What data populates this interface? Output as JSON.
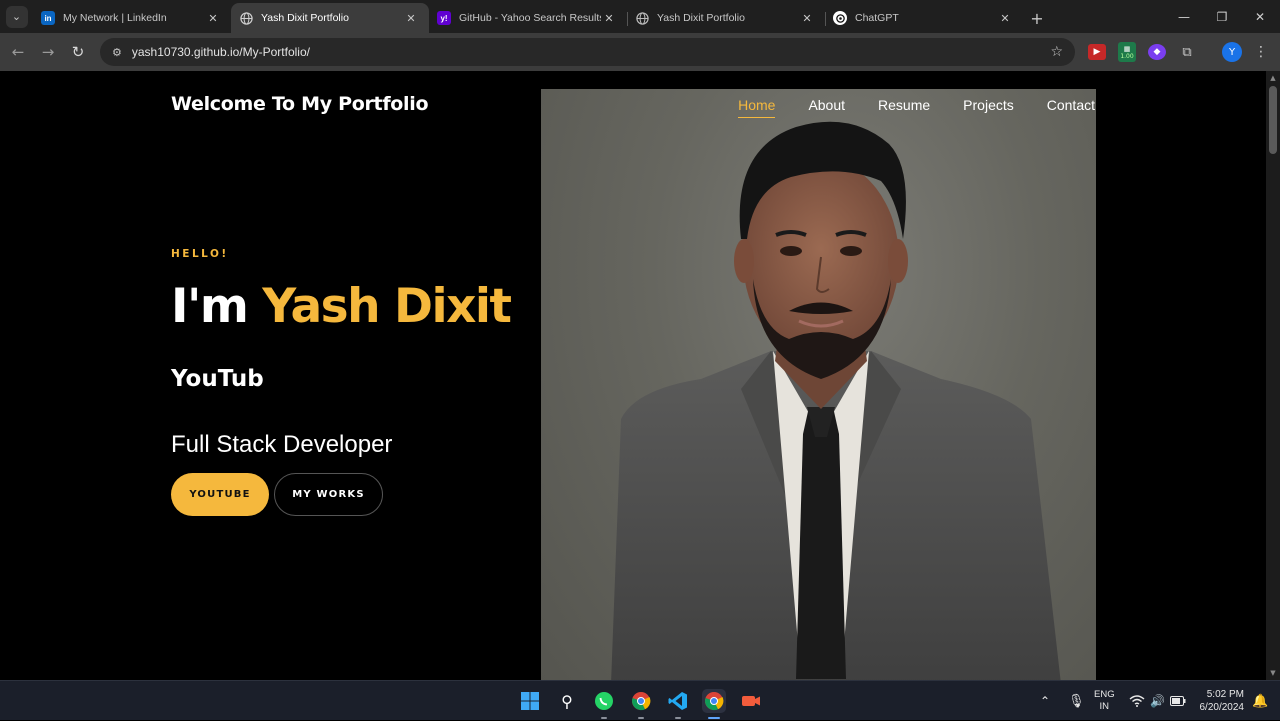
{
  "browser": {
    "tabs": [
      {
        "title": "My Network | LinkedIn",
        "favicon": "linkedin-icon",
        "favicon_text": "in",
        "color": "#0a66c2",
        "active": false
      },
      {
        "title": "Yash Dixit Portfolio",
        "favicon": "globe-icon",
        "favicon_text": "",
        "color": "#555555",
        "active": true
      },
      {
        "title": "GitHub - Yahoo Search Results",
        "favicon": "yahoo-icon",
        "favicon_text": "y!",
        "color": "#6001d2",
        "active": false
      },
      {
        "title": "Yash Dixit Portfolio",
        "favicon": "globe-icon",
        "favicon_text": "",
        "color": "#555555",
        "active": false
      },
      {
        "title": "ChatGPT",
        "favicon": "chatgpt-icon",
        "favicon_text": "",
        "color": "#ffffff",
        "active": false
      }
    ],
    "url": "yash10730.github.io/My-Portfolio/",
    "profile_initial": "Y",
    "extension_badge": "1.00"
  },
  "page": {
    "brand": "Welcome To My Portfolio",
    "nav": [
      {
        "label": "Home",
        "active": true
      },
      {
        "label": "About",
        "active": false
      },
      {
        "label": "Resume",
        "active": false
      },
      {
        "label": "Projects",
        "active": false
      },
      {
        "label": "Contact",
        "active": false
      }
    ],
    "hello": "HELLO!",
    "intro_prefix": "I'm",
    "intro_name": "Yash Dixit",
    "typing_text": "YouTub",
    "role": "Full Stack Developer",
    "buttons": {
      "youtube": "YOUTUBE",
      "works": "MY WORKS"
    },
    "accent_color": "#f5b83d"
  },
  "taskbar": {
    "lang_top": "ENG",
    "lang_bottom": "IN",
    "time": "5:02 PM",
    "date": "6/20/2024"
  }
}
